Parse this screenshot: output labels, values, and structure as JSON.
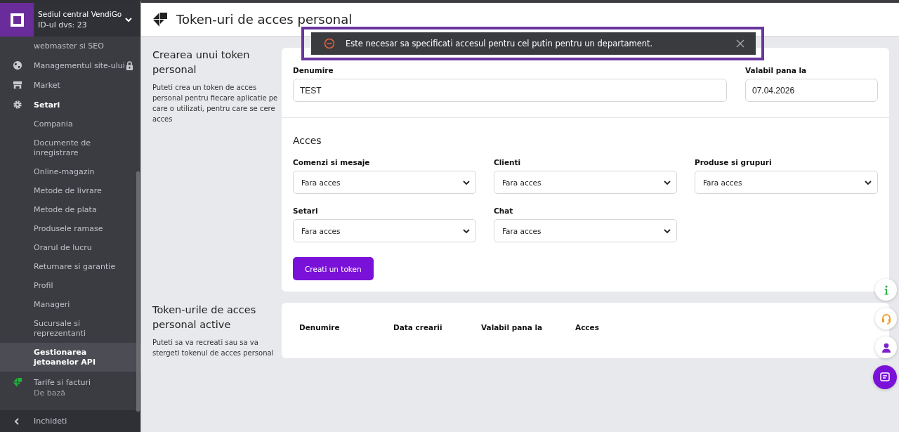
{
  "sidebar": {
    "account": {
      "name": "Sediul central VendiGo",
      "id": "ID-ul dvs: 23"
    },
    "items": [
      {
        "label": "webmaster si SEO",
        "kind": "sub",
        "selected": false
      },
      {
        "label": "Managementul site-ului",
        "kind": "website",
        "locked": true,
        "expanded": false
      },
      {
        "label": "Market",
        "kind": "market",
        "locked": false,
        "expanded": false
      },
      {
        "label": "Setari",
        "kind": "settings",
        "locked": false,
        "expanded": true
      },
      {
        "label": "Compania",
        "kind": "sub",
        "selected": false
      },
      {
        "label": "Documente de inregistrare",
        "kind": "sub",
        "selected": false
      },
      {
        "label": "Online-magazin",
        "kind": "sub",
        "selected": false
      },
      {
        "label": "Metode de livrare",
        "kind": "sub",
        "selected": false
      },
      {
        "label": "Metode de plata",
        "kind": "sub",
        "selected": false
      },
      {
        "label": "Produsele ramase",
        "kind": "sub",
        "selected": false
      },
      {
        "label": "Orarul de lucru",
        "kind": "sub",
        "selected": false
      },
      {
        "label": "Returnare si garantie",
        "kind": "sub",
        "selected": false
      },
      {
        "label": "Profil",
        "kind": "sub",
        "selected": false
      },
      {
        "label": "Manageri",
        "kind": "sub",
        "selected": false
      },
      {
        "label": "Sucursale si reprezentanti",
        "kind": "sub",
        "selected": false
      },
      {
        "label": "Gestionarea jetoanelor API",
        "kind": "sub",
        "selected": true
      },
      {
        "label": "Tarife si facturi",
        "sublabel": "De bază",
        "kind": "plan"
      }
    ],
    "footer": {
      "label": "Inchideti"
    }
  },
  "header": {
    "title": "Token-uri de acces personal"
  },
  "toast": {
    "kind": "error",
    "message": "Este necesar sa specificati accesul pentru cel putin pentru un departament."
  },
  "create_section": {
    "title": "Crearea unui token personal",
    "description": "Puteti crea un token de acces personal pentru fiecare aplicatie pe care o utilizati, pentru care se cere acces",
    "fields": [
      {
        "label": "Denumire",
        "value": "TEST"
      },
      {
        "label": "Valabil pana la",
        "value": "07.04.2026"
      }
    ],
    "access_title": "Acces",
    "access": [
      {
        "label": "Comenzi si mesaje",
        "value": "Fara acces"
      },
      {
        "label": "Clienti",
        "value": "Fara acces"
      },
      {
        "label": "Produse si grupuri",
        "value": "Fara acces"
      },
      {
        "label": "Setari",
        "value": "Fara acces"
      },
      {
        "label": "Chat",
        "value": "Fara acces"
      }
    ],
    "button": "Creati un token"
  },
  "active_section": {
    "title": "Token-urile de acces personal active",
    "description": "Puteti sa va recreati sau sa va stergeti tokenul de acces personal",
    "columns": [
      "Denumire",
      "Data crearii",
      "Valabil pana la",
      "Acces"
    ]
  },
  "floating_buttons": [
    {
      "kind": "info"
    },
    {
      "kind": "support"
    },
    {
      "kind": "user"
    },
    {
      "kind": "chat"
    }
  ]
}
